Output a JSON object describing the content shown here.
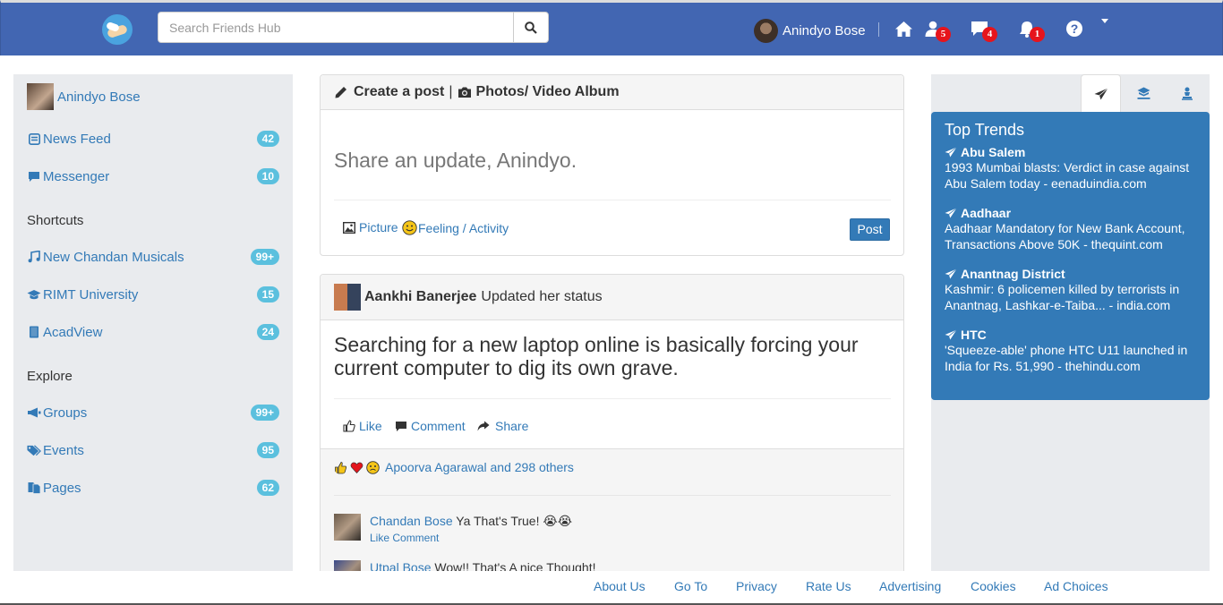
{
  "header": {
    "search_placeholder": "Search Friends Hub",
    "user_name": "Anindyo Bose",
    "friend_requests": "5",
    "messages": "4",
    "notifications": "1"
  },
  "sidebar": {
    "user_name": "Anindyo Bose",
    "items": [
      {
        "label": "News Feed",
        "count": "42",
        "icon": "newspaper-icon"
      },
      {
        "label": "Messenger",
        "count": "10",
        "icon": "comment-icon"
      }
    ],
    "shortcuts_title": "Shortcuts",
    "shortcuts": [
      {
        "label": "New Chandan Musicals",
        "count": "99+",
        "icon": "music-icon"
      },
      {
        "label": "RIMT University",
        "count": "15",
        "icon": "graduation-cap-icon"
      },
      {
        "label": "AcadView",
        "count": "24",
        "icon": "book-icon"
      }
    ],
    "explore_title": "Explore",
    "explore": [
      {
        "label": "Groups",
        "count": "99+",
        "icon": "megaphone-icon"
      },
      {
        "label": "Events",
        "count": "95",
        "icon": "tags-icon"
      },
      {
        "label": "Pages",
        "count": "62",
        "icon": "pages-icon"
      }
    ]
  },
  "composer": {
    "create_post": "Create a post",
    "separator": "|",
    "photos": "Photos/ Video Album",
    "prompt": "Share an update, Anindyo.",
    "picture": "Picture",
    "feeling": "Feeling / Activity",
    "post_button": "Post"
  },
  "feed": {
    "author": "Aankhi Banerjee",
    "action": "Updated her status",
    "text": "Searching for a new laptop online is basically forcing your current computer to dig its own grave.",
    "like": "Like",
    "comment": "Comment",
    "share": "Share",
    "reactions_text": "Apoorva Agarawal and 298 others",
    "comments": [
      {
        "name": "Chandan Bose",
        "text": "Ya That's True! 😭😭",
        "actions": "Like Comment"
      },
      {
        "name": "Utpal Bose",
        "text": "Wow!! That's A nice Thought!",
        "actions": ""
      }
    ]
  },
  "trends": {
    "title": "Top Trends",
    "items": [
      {
        "title": "Abu Salem",
        "desc": "1993 Mumbai blasts: Verdict in case against Abu Salem today - eenaduindia.com"
      },
      {
        "title": "Aadhaar",
        "desc": "Aadhaar Mandatory for New Bank Account, Transactions Above 50K - thequint.com"
      },
      {
        "title": "Anantnag District",
        "desc": "Kashmir: 6 policemen killed by terrorists in Anantnag, Lashkar-e-Taiba... - india.com"
      },
      {
        "title": "HTC",
        "desc": "'Squeeze-able' phone HTC U11 launched in India for Rs. 51,990 - thehindu.com"
      }
    ]
  },
  "footer": [
    "About Us",
    "Go To",
    "Privacy",
    "Rate Us",
    "Advertising",
    "Cookies",
    "Ad Choices"
  ]
}
